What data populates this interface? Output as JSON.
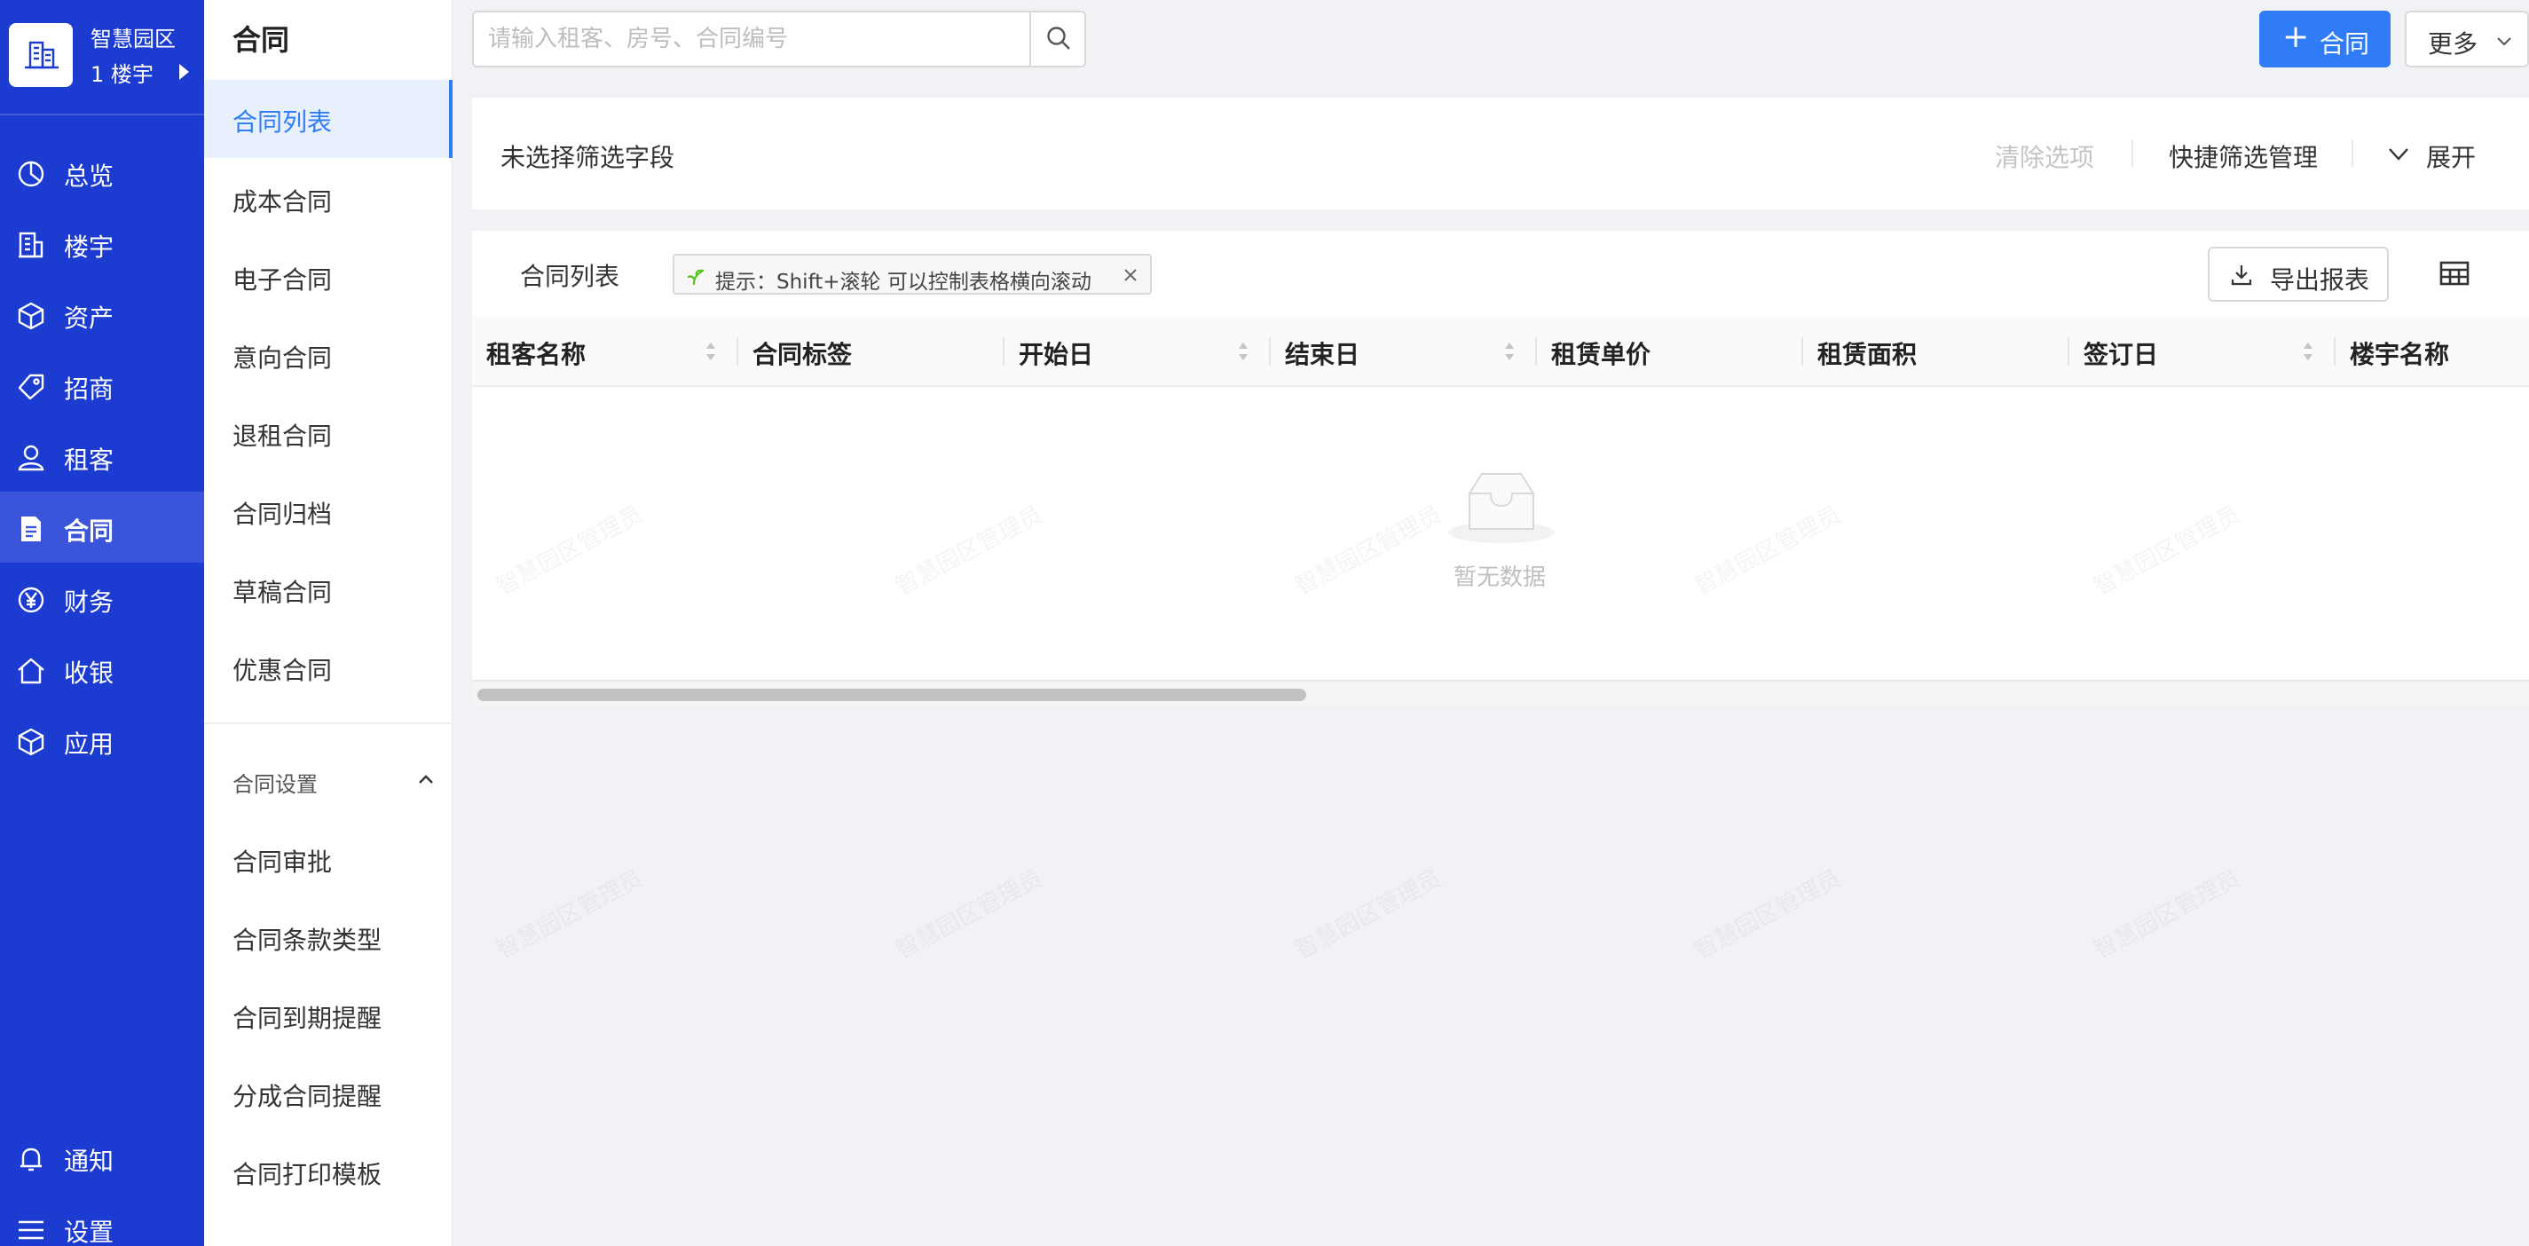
{
  "brand": {
    "name": "智慧园区",
    "building": "1 楼宇"
  },
  "nav": {
    "items": [
      {
        "label": "总览",
        "icon": "pie-chart-icon"
      },
      {
        "label": "楼宇",
        "icon": "building-icon"
      },
      {
        "label": "资产",
        "icon": "box-icon"
      },
      {
        "label": "招商",
        "icon": "tag-icon"
      },
      {
        "label": "租客",
        "icon": "user-icon"
      },
      {
        "label": "合同",
        "icon": "document-icon",
        "active": true
      },
      {
        "label": "财务",
        "icon": "yen-icon"
      },
      {
        "label": "收银",
        "icon": "home-icon"
      },
      {
        "label": "应用",
        "icon": "cube-icon"
      }
    ],
    "bottom": [
      {
        "label": "通知",
        "icon": "bell-icon"
      },
      {
        "label": "设置",
        "icon": "menu-icon"
      }
    ]
  },
  "submenu": {
    "title": "合同",
    "items": [
      "合同列表",
      "成本合同",
      "电子合同",
      "意向合同",
      "退租合同",
      "合同归档",
      "草稿合同",
      "优惠合同"
    ],
    "active_index": 0,
    "group_title": "合同设置",
    "group_items": [
      "合同审批",
      "合同条款类型",
      "合同到期提醒",
      "分成合同提醒",
      "合同打印模板"
    ]
  },
  "search": {
    "placeholder": "请输入租客、房号、合同编号"
  },
  "toolbar": {
    "add_label": "合同",
    "more_label": "更多"
  },
  "filter": {
    "empty_text": "未选择筛选字段",
    "clear_label": "清除选项",
    "quick_label": "快捷筛选管理",
    "expand_label": "展开"
  },
  "table": {
    "title": "合同列表",
    "tip": "提示：Shift+滚轮 可以控制表格横向滚动",
    "export_label": "导出报表",
    "columns": [
      {
        "label": "租客名称",
        "sortable": true
      },
      {
        "label": "合同标签",
        "sortable": false
      },
      {
        "label": "开始日",
        "sortable": true
      },
      {
        "label": "结束日",
        "sortable": true
      },
      {
        "label": "租赁单价",
        "sortable": false
      },
      {
        "label": "租赁面积",
        "sortable": false
      },
      {
        "label": "签订日",
        "sortable": true
      },
      {
        "label": "楼宇名称",
        "sortable": false
      }
    ],
    "empty_text": "暂无数据"
  },
  "watermark": "智慧园区管理员",
  "colors": {
    "nav_bg": "#1c3bd0",
    "primary": "#2f7cf6",
    "page_bg": "#f0f2f5"
  }
}
